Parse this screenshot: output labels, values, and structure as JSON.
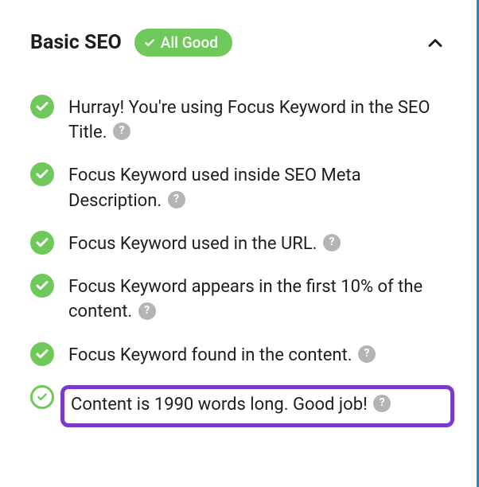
{
  "header": {
    "title": "Basic SEO",
    "badge_label": "All Good"
  },
  "items": [
    {
      "text": "Hurray! You're using Focus Keyword in the SEO Title.",
      "bullet": "filled",
      "highlighted": false
    },
    {
      "text": "Focus Keyword used inside SEO Meta Description.",
      "bullet": "filled",
      "highlighted": false
    },
    {
      "text": "Focus Keyword used in the URL.",
      "bullet": "filled",
      "highlighted": false
    },
    {
      "text": "Focus Keyword appears in the first 10% of the content.",
      "bullet": "filled",
      "highlighted": false
    },
    {
      "text": "Focus Keyword found in the content.",
      "bullet": "filled",
      "highlighted": false
    },
    {
      "text": "Content is 1990 words long. Good job!",
      "bullet": "outline",
      "highlighted": true
    }
  ],
  "icons": {
    "help_glyph": "?"
  },
  "colors": {
    "accent_green": "#6fc95a",
    "highlight_purple": "#7a3cc8",
    "help_gray": "#b4b4b4"
  }
}
